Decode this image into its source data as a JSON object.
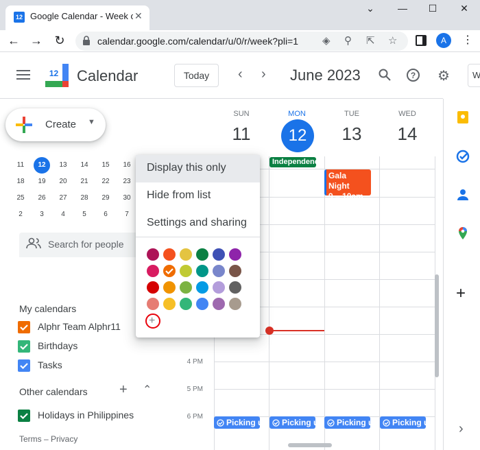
{
  "browser": {
    "tab_title": "Google Calendar - Week of",
    "tab_favicon_text": "12",
    "url": "calendar.google.com/calendar/u/0/r/week?pli=1",
    "profile_initial": "A"
  },
  "header": {
    "logo_text": "12",
    "app_title": "Calendar",
    "today_label": "Today",
    "month": "June 2023",
    "view_stub": "W"
  },
  "create": {
    "label": "Create"
  },
  "mini_calendar": {
    "rows": [
      [
        "11",
        "12",
        "13",
        "14",
        "15",
        "16"
      ],
      [
        "18",
        "19",
        "20",
        "21",
        "22",
        "23"
      ],
      [
        "25",
        "26",
        "27",
        "28",
        "29",
        "30"
      ],
      [
        "2",
        "3",
        "4",
        "5",
        "6",
        "7"
      ]
    ],
    "today": "12"
  },
  "search_people": {
    "placeholder": "Search for people"
  },
  "my_calendars": {
    "title": "My calendars",
    "items": [
      {
        "label": "Alphr Team Alphr11",
        "color": "#ef6c00"
      },
      {
        "label": "Birthdays",
        "color": "#33b679"
      },
      {
        "label": "Tasks",
        "color": "#4285f4"
      }
    ]
  },
  "other_calendars": {
    "title": "Other calendars",
    "items": [
      {
        "label": "Holidays in Philippines",
        "color": "#0b8043"
      }
    ]
  },
  "footer": {
    "text": "Terms – Privacy"
  },
  "week": {
    "days": [
      {
        "name": "SUN",
        "num": "11"
      },
      {
        "name": "MON",
        "num": "12"
      },
      {
        "name": "TUE",
        "num": "13"
      },
      {
        "name": "WED",
        "num": "14"
      }
    ],
    "hours": [
      "4 PM",
      "5 PM",
      "6 PM"
    ],
    "allday_event": "Independence Day",
    "gala_title": "Gala Night",
    "gala_time": "9 – 10am",
    "task_label": "Picking up"
  },
  "menu": {
    "items": [
      "Display this only",
      "Hide from list",
      "Settings and sharing"
    ],
    "palette": [
      [
        "#ad1457",
        "#f4511e",
        "#e4c441",
        "#0b8043",
        "#3f51b5",
        "#8e24aa"
      ],
      [
        "#d81b60",
        "#ef6c00",
        "#c0ca33",
        "#009688",
        "#7986cb",
        "#795548"
      ],
      [
        "#d50000",
        "#f09300",
        "#7cb342",
        "#039be5",
        "#b39ddb",
        "#616161"
      ],
      [
        "#e67c73",
        "#f6bf26",
        "#33b679",
        "#4285f4",
        "#9e69af",
        "#a79b8e"
      ]
    ],
    "selected_color": "#ef6c00"
  }
}
